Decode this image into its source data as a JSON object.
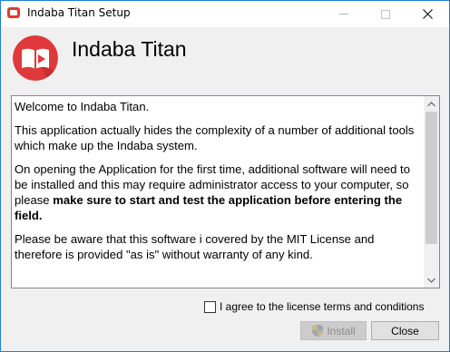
{
  "window": {
    "title": "Indaba Titan Setup",
    "accent_color": "#e0393b"
  },
  "header": {
    "app_name": "Indaba Titan"
  },
  "license_text": {
    "p1": "Welcome to Indaba Titan.",
    "p2": "This application actually hides the complexity of a number of additional tools which make up the Indaba system.",
    "p3_start": "On opening the Application for the first time, additional software will need to be installed and this may require administrator access to your computer, so please ",
    "p3_bold": "make sure to start and test the application before entering the field.",
    "p4": "Please be aware that this software i covered by the MIT License  and therefore is provided \"as is\" without warranty of any kind."
  },
  "agree": {
    "label": "I agree to the license terms and conditions",
    "checked": false
  },
  "buttons": {
    "install_label": "Install",
    "install_enabled": false,
    "install_icon": "uac-shield-icon",
    "close_label": "Close"
  }
}
